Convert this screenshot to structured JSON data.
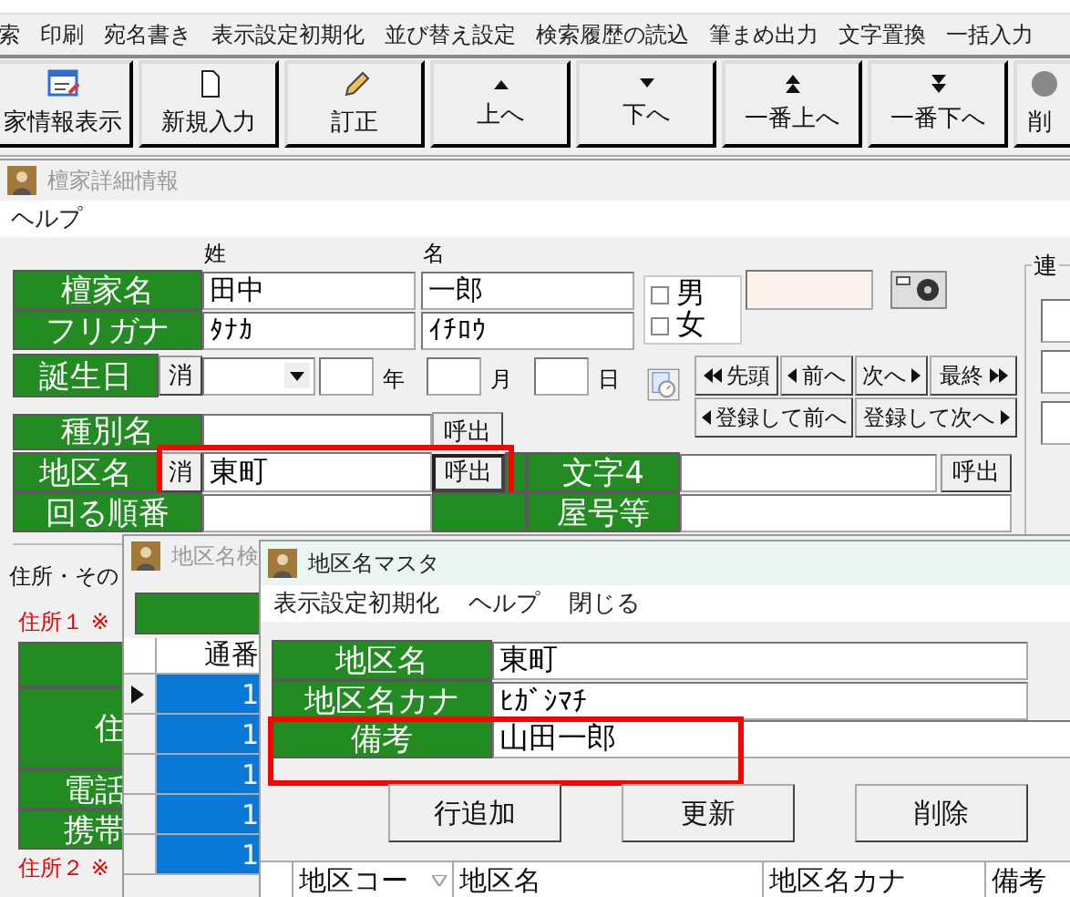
{
  "main": {
    "menu": [
      "索",
      "印刷",
      "宛名書き",
      "表示設定初期化",
      "並び替え設定",
      "検索履歴の読込",
      "筆まめ出力",
      "文字置換",
      "一括入力"
    ],
    "toolbar": [
      {
        "kind": "view",
        "label": "家情報表示"
      },
      {
        "kind": "new",
        "label": "新規入力"
      },
      {
        "kind": "edit",
        "label": "訂正"
      },
      {
        "kind": "up",
        "label": "上へ"
      },
      {
        "kind": "down",
        "label": "下へ"
      },
      {
        "kind": "top",
        "label": "一番上へ"
      },
      {
        "kind": "bottom",
        "label": "一番下へ"
      },
      {
        "kind": "delete",
        "label": "削"
      }
    ]
  },
  "detail": {
    "title": "檀家詳細情報",
    "menu": [
      "ヘルプ"
    ],
    "col_headers": [
      "姓",
      "名"
    ],
    "name": {
      "label": "檀家名",
      "last": "田中",
      "first": "一郎"
    },
    "furigana": {
      "label": "フリガナ",
      "last": "ﾀﾅｶ",
      "first": "ｲﾁﾛｳ"
    },
    "gender": [
      {
        "label": "男",
        "checked": false
      },
      {
        "label": "女",
        "checked": false
      }
    ],
    "birth": {
      "label": "誕生日",
      "clear": "消",
      "year": "年",
      "month": "月",
      "day": "日"
    },
    "nav": [
      {
        "kind": "first",
        "label": "先頭"
      },
      {
        "kind": "prev",
        "label": "前へ"
      },
      {
        "kind": "next",
        "label": "次へ"
      },
      {
        "kind": "last",
        "label": "最終"
      }
    ],
    "nav_save": [
      {
        "kind": "prev",
        "label": "登録して前へ"
      },
      {
        "kind": "next",
        "label": "登録して次へ"
      }
    ],
    "group_title": "連",
    "type": {
      "label": "種別名",
      "call": "呼出"
    },
    "district": {
      "label": "地区名",
      "clear": "消",
      "value": "東町",
      "call": "呼出"
    },
    "char4": {
      "label": "文字4",
      "call": "呼出"
    },
    "order": {
      "label": "回る順番"
    },
    "house": {
      "label": "屋号等"
    },
    "section": "住所・その",
    "addr1": "住所１ ※",
    "addr_labels": [
      "住",
      "電話",
      "携帯"
    ],
    "addr2": "住所２ ※"
  },
  "search": {
    "title": "地区名検",
    "header": "通番",
    "rows": [
      {
        "value": "1",
        "selected": true
      },
      {
        "value": "1",
        "selected": false
      },
      {
        "value": "1",
        "selected": false
      },
      {
        "value": "1",
        "selected": false
      },
      {
        "value": "1",
        "selected": false
      }
    ]
  },
  "master": {
    "title": "地区名マスタ",
    "menu": [
      "表示設定初期化",
      "ヘルプ",
      "閉じる"
    ],
    "fields": [
      {
        "label": "地区名",
        "value": "東町"
      },
      {
        "label": "地区名カナ",
        "value": "ﾋｶﾞｼﾏﾁ"
      },
      {
        "label": "備考",
        "value": "山田一郎"
      }
    ],
    "buttons": [
      "行追加",
      "更新",
      "削除"
    ],
    "columns": [
      "地区コー",
      "地区名",
      "地区名カナ",
      "備考"
    ]
  }
}
